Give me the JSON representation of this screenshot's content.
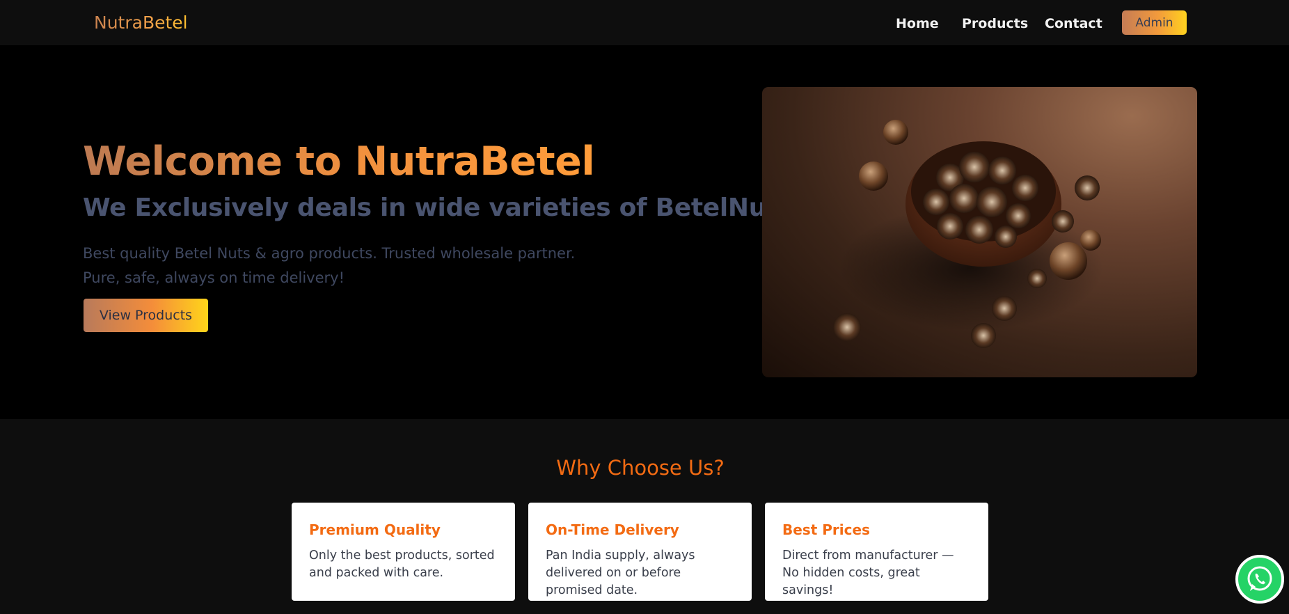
{
  "nav": {
    "brand": "NutraBetel",
    "links": [
      "Home",
      "Products",
      "Contact"
    ],
    "admin_label": "Admin"
  },
  "hero": {
    "title": "Welcome to NutraBetel",
    "subtitle": "We Exclusively deals in wide varieties of BetelNuts.",
    "cursor": "|",
    "description": [
      "Best quality Betel Nuts & agro products. Trusted wholesale partner.",
      "Pure, safe, always on time delivery!"
    ],
    "button_label": "View Products",
    "image_icon": "betel-nuts-bowl-photo"
  },
  "why": {
    "title": "Why Choose Us?",
    "cards": [
      {
        "title": "Premium Quality",
        "text": "Only the best products, sorted and packed with care."
      },
      {
        "title": "On-Time Delivery",
        "text": "Pan India supply, always delivered on or before promised date."
      },
      {
        "title": "Best Prices",
        "text": "Direct from manufacturer — No hidden costs, great savings!"
      }
    ]
  },
  "whatsapp": {
    "icon": "whatsapp-icon",
    "color": "#25d366"
  },
  "colors": {
    "accent_orange": "#f36b13",
    "nav_bg": "#0e0e0e",
    "hero_bg": "#000000",
    "subtitle_gray": "#4a5470"
  }
}
